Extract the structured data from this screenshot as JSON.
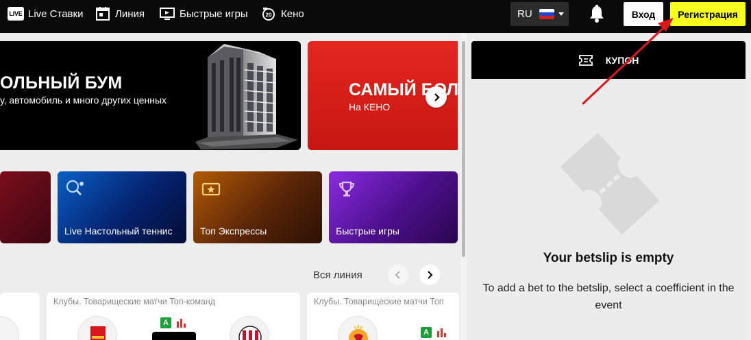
{
  "nav": {
    "live": {
      "badge": "LIVE",
      "label": "Live Ставки"
    },
    "line": {
      "label": "Линия"
    },
    "quick": {
      "label": "Быстрые игры"
    },
    "keno": {
      "label": "Кено"
    }
  },
  "lang": {
    "code": "RU"
  },
  "auth": {
    "login": "Вход",
    "register": "Регистрация"
  },
  "banners": [
    {
      "title": "ОЛЬНЫЙ БУМ",
      "subtitle": "у, автомобиль и много других ценных"
    },
    {
      "title": "САМЫЙ БОЛ",
      "subtitle": "На КЕНО"
    }
  ],
  "tiles": [
    {
      "label": ""
    },
    {
      "label": "Live Настольный теннис"
    },
    {
      "label": "Топ Экспрессы"
    },
    {
      "label": "Быстрые игры"
    }
  ],
  "section": {
    "all_line": "Вся линия"
  },
  "cards": [
    {
      "caption": ""
    },
    {
      "caption": "Клубы. Товарищеские матчи Топ-команд"
    },
    {
      "caption": "Клубы. Товарищеские матчи Топ"
    }
  ],
  "coupon": {
    "header": "КУПОН",
    "empty_title": "Your betslip is empty",
    "empty_text": "To add a bet to the betslip, select a coefficient in the event"
  },
  "colors": {
    "accent_yellow": "#f7ff1e",
    "topbar": "#0a0a0a",
    "keno_red": "#e3271f",
    "annotation_red": "#e0161b"
  }
}
